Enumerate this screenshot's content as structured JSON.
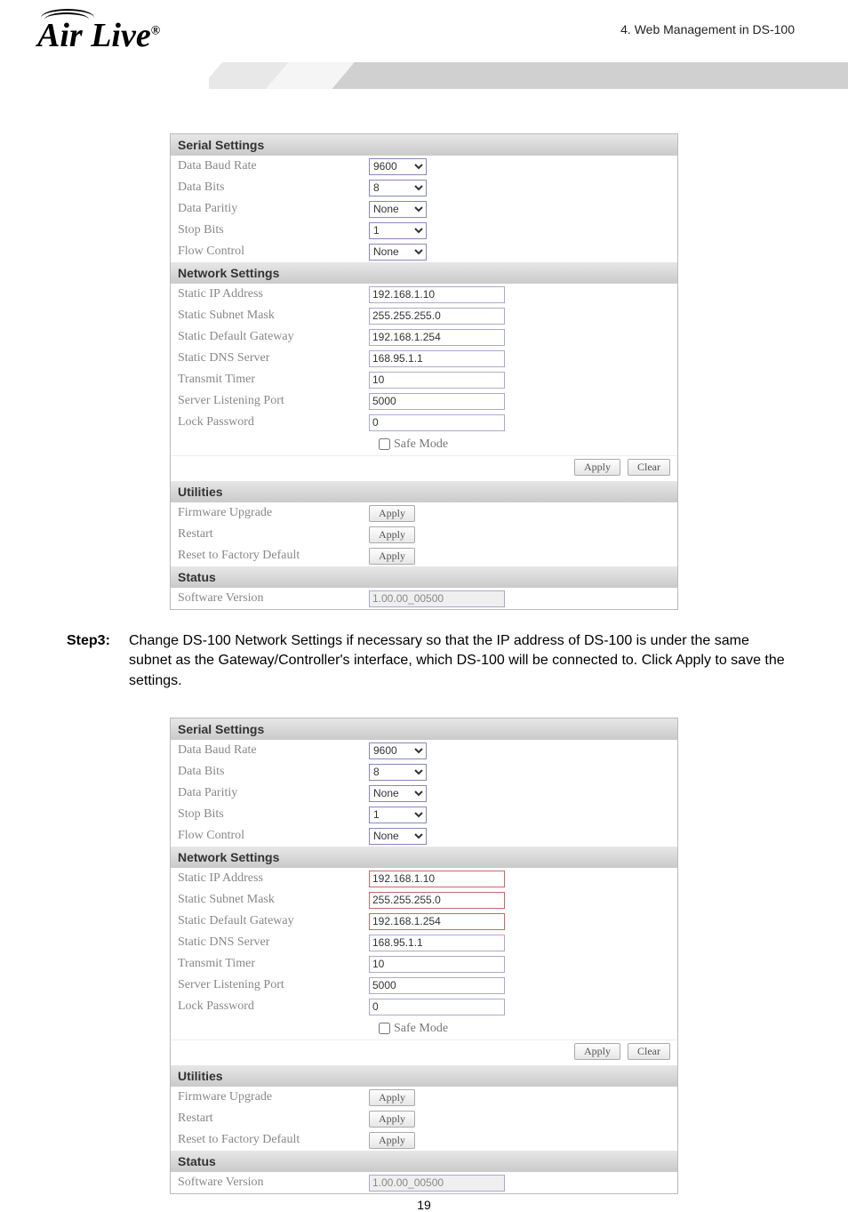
{
  "header": {
    "logo_text": "Air Live",
    "chapter": "4.  Web  Management  in  DS-100"
  },
  "panel1": {
    "sections": {
      "serial": "Serial Settings",
      "network": "Network Settings",
      "utilities": "Utilities",
      "status": "Status"
    },
    "rows": {
      "baud_label": "Data Baud Rate",
      "baud_val": "9600",
      "bits_label": "Data Bits",
      "bits_val": "8",
      "parity_label": "Data Paritiy",
      "parity_val": "None",
      "stop_label": "Stop Bits",
      "stop_val": "1",
      "flow_label": "Flow Control",
      "flow_val": "None",
      "ip_label": "Static IP Address",
      "ip_val": "192.168.1.10",
      "mask_label": "Static Subnet Mask",
      "mask_val": "255.255.255.0",
      "gw_label": "Static Default Gateway",
      "gw_val": "192.168.1.254",
      "dns_label": "Static DNS Server",
      "dns_val": "168.95.1.1",
      "timer_label": "Transmit Timer",
      "timer_val": "10",
      "port_label": "Server Listening Port",
      "port_val": "5000",
      "lock_label": "Lock Password",
      "lock_val": "0",
      "safe_label": "Safe Mode",
      "apply_btn": "Apply",
      "clear_btn": "Clear",
      "fw_label": "Firmware Upgrade",
      "fw_btn": "Apply",
      "restart_label": "Restart",
      "restart_btn": "Apply",
      "reset_label": "Reset to Factory Default",
      "reset_btn": "Apply",
      "ver_label": "Software Version",
      "ver_val": "1.00.00_00500"
    }
  },
  "step3": {
    "tag": "Step3:",
    "text": "Change DS-100 Network Settings if necessary so that the IP address of DS-100 is under the same subnet as the Gateway/Controller's interface, which DS-100 will be connected to. Click Apply to save the settings."
  },
  "panel2": {
    "sections": {
      "serial": "Serial Settings",
      "network": "Network Settings",
      "utilities": "Utilities",
      "status": "Status"
    },
    "rows": {
      "baud_label": "Data Baud Rate",
      "baud_val": "9600",
      "bits_label": "Data Bits",
      "bits_val": "8",
      "parity_label": "Data Paritiy",
      "parity_val": "None",
      "stop_label": "Stop Bits",
      "stop_val": "1",
      "flow_label": "Flow Control",
      "flow_val": "None",
      "ip_label": "Static IP Address",
      "ip_val": "192.168.1.10",
      "mask_label": "Static Subnet Mask",
      "mask_val": "255.255.255.0",
      "gw_label": "Static Default Gateway",
      "gw_val": "192.168.1.254",
      "dns_label": "Static DNS Server",
      "dns_val": "168.95.1.1",
      "timer_label": "Transmit Timer",
      "timer_val": "10",
      "port_label": "Server Listening Port",
      "port_val": "5000",
      "lock_label": "Lock Password",
      "lock_val": "0",
      "safe_label": "Safe Mode",
      "apply_btn": "Apply",
      "clear_btn": "Clear",
      "fw_label": "Firmware Upgrade",
      "fw_btn": "Apply",
      "restart_label": "Restart",
      "restart_btn": "Apply",
      "reset_label": "Reset to Factory Default",
      "reset_btn": "Apply",
      "ver_label": "Software Version",
      "ver_val": "1.00.00_00500"
    }
  },
  "page_number": "19"
}
